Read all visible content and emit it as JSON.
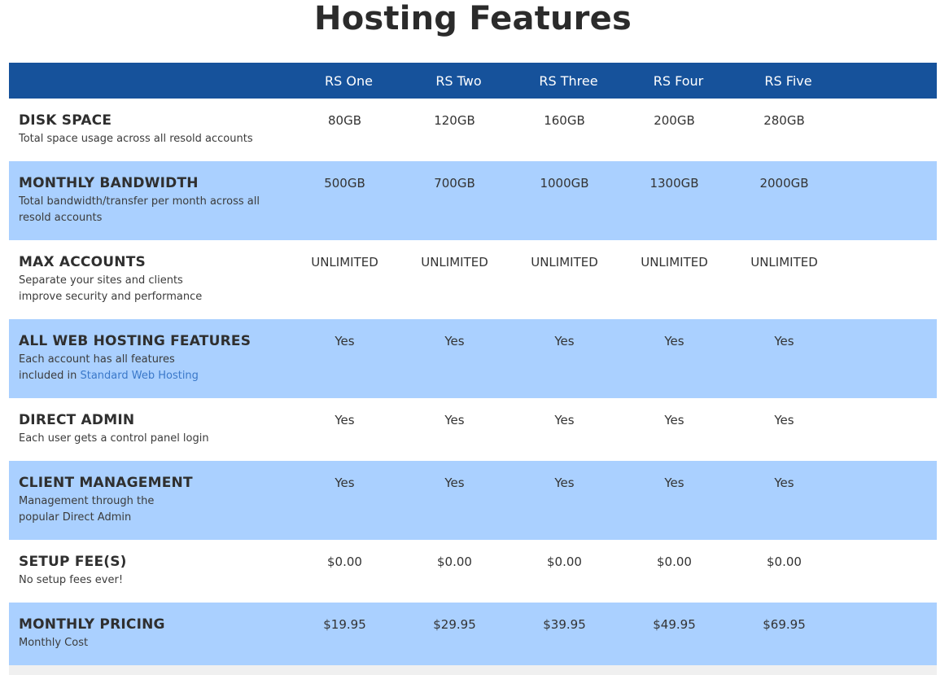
{
  "title": "Hosting Features",
  "columns": [
    "RS One",
    "RS Two",
    "RS Three",
    "RS Four",
    "RS Five"
  ],
  "rows": [
    {
      "name": "DISK SPACE",
      "desc": "Total space usage across all resold accounts",
      "values": [
        "80GB",
        "120GB",
        "160GB",
        "200GB",
        "280GB"
      ]
    },
    {
      "name": "MONTHLY BANDWIDTH",
      "desc": "Total bandwidth/transfer per month across all\nresold accounts",
      "values": [
        "500GB",
        "700GB",
        "1000GB",
        "1300GB",
        "2000GB"
      ]
    },
    {
      "name": "MAX ACCOUNTS",
      "desc": "Separate your sites and clients\nimprove security and performance",
      "values": [
        "UNLIMITED",
        "UNLIMITED",
        "UNLIMITED",
        "UNLIMITED",
        "UNLIMITED"
      ]
    },
    {
      "name": "ALL WEB HOSTING FEATURES",
      "desc_prefix": "Each account has all features\nincluded in ",
      "desc_link": "Standard Web Hosting",
      "values": [
        "Yes",
        "Yes",
        "Yes",
        "Yes",
        "Yes"
      ]
    },
    {
      "name": "DIRECT ADMIN",
      "desc": "Each user gets a control panel login",
      "values": [
        "Yes",
        "Yes",
        "Yes",
        "Yes",
        "Yes"
      ]
    },
    {
      "name": "CLIENT MANAGEMENT",
      "desc": "Management through the\npopular Direct Admin",
      "values": [
        "Yes",
        "Yes",
        "Yes",
        "Yes",
        "Yes"
      ]
    },
    {
      "name": "SETUP FEE(S)",
      "desc": "No setup fees ever!",
      "values": [
        "$0.00",
        "$0.00",
        "$0.00",
        "$0.00",
        "$0.00"
      ]
    },
    {
      "name": "MONTHLY PRICING",
      "desc": "Monthly Cost",
      "values": [
        "$19.95",
        "$29.95",
        "$39.95",
        "$49.95",
        "$69.95"
      ]
    }
  ],
  "colors": {
    "header_bg": "#16529b",
    "alt_row_bg": "#aad0ff",
    "link": "#3a78c9"
  }
}
